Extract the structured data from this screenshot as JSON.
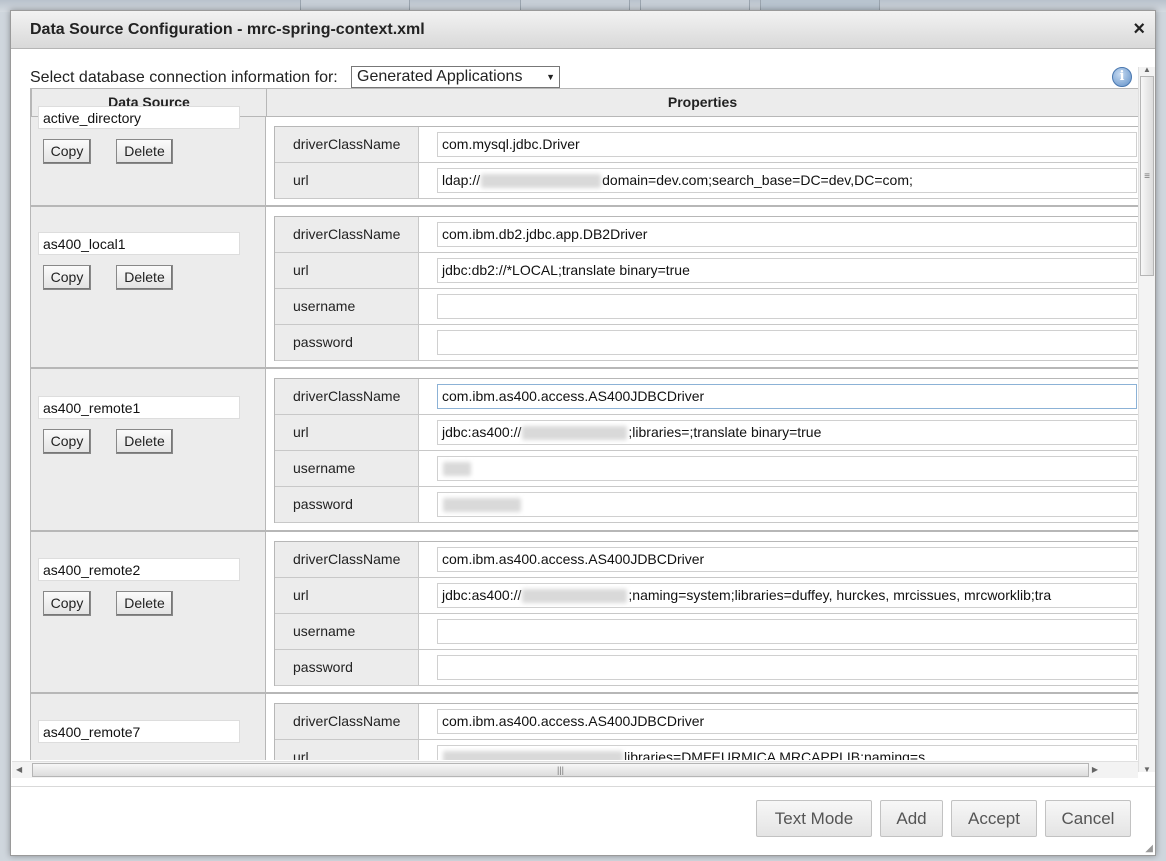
{
  "dialog": {
    "title": "Data Source Configuration - mrc-spring-context.xml",
    "close_label": "×"
  },
  "selector": {
    "label": "Select database connection information for:",
    "selected": "Generated Applications"
  },
  "table": {
    "header_datasource": "Data Source",
    "header_properties": "Properties",
    "copy_label": "Copy",
    "delete_label": "Delete",
    "rows": [
      {
        "name": "active_directory",
        "props": [
          {
            "key": "driverClassName",
            "value": "com.mysql.jdbc.Driver"
          },
          {
            "key": "url",
            "value_pre": "ldap://",
            "value_post": "domain=dev.com;search_base=DC=dev,DC=com;"
          }
        ]
      },
      {
        "name": "as400_local1",
        "props": [
          {
            "key": "driverClassName",
            "value": "com.ibm.db2.jdbc.app.DB2Driver"
          },
          {
            "key": "url",
            "value": " jdbc:db2://*LOCAL;translate binary=true"
          },
          {
            "key": "username",
            "value": ""
          },
          {
            "key": "password",
            "value": ""
          }
        ]
      },
      {
        "name": "as400_remote1",
        "props": [
          {
            "key": "driverClassName",
            "value": "com.ibm.as400.access.AS400JDBCDriver"
          },
          {
            "key": "url",
            "value_pre": "jdbc:as400://",
            "value_post": ";libraries=;translate binary=true"
          },
          {
            "key": "username",
            "value": ""
          },
          {
            "key": "password",
            "value": ""
          }
        ]
      },
      {
        "name": "as400_remote2",
        "props": [
          {
            "key": "driverClassName",
            "value": "com.ibm.as400.access.AS400JDBCDriver"
          },
          {
            "key": "url",
            "value_pre": "jdbc:as400://",
            "value_post": ";naming=system;libraries=duffey, hurckes, mrcissues, mrcworklib;tra"
          },
          {
            "key": "username",
            "value": ""
          },
          {
            "key": "password",
            "value": ""
          }
        ]
      },
      {
        "name": "as400_remote7",
        "props": [
          {
            "key": "driverClassName",
            "value": "com.ibm.as400.access.AS400JDBCDriver"
          },
          {
            "key": "url",
            "value_post": "libraries=DMFEURMICA MRCAPPLIB;naming=s"
          }
        ]
      }
    ]
  },
  "footer": {
    "text_mode_label": "Text Mode",
    "add_label": "Add",
    "accept_label": "Accept",
    "cancel_label": "Cancel"
  },
  "icons": {
    "info": "info-icon",
    "close": "close-icon"
  },
  "colors": {
    "header_bg": "#ececec",
    "border": "#b7b7b7",
    "titlebar": "#e2e2e2"
  }
}
